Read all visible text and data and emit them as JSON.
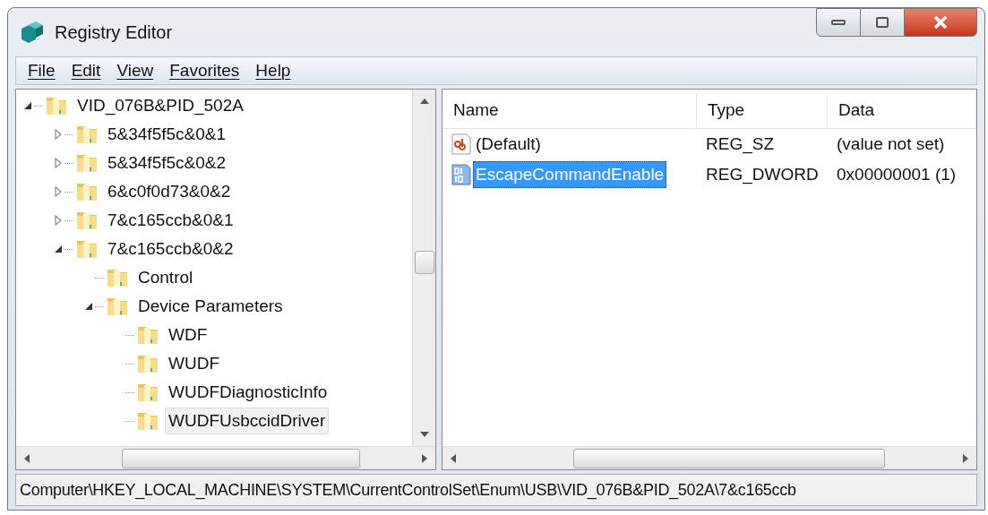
{
  "window": {
    "title": "Registry Editor"
  },
  "menu": [
    {
      "label": "File"
    },
    {
      "label": "Edit"
    },
    {
      "label": "View"
    },
    {
      "label": "Favorites"
    },
    {
      "label": "Help"
    }
  ],
  "tree": [
    {
      "label": "VID_076B&PID_502A",
      "kind": "branch",
      "expanded": true,
      "selected": false,
      "children": [
        {
          "label": "5&34f5f5c&0&1",
          "kind": "branch",
          "expanded": false,
          "selected": false
        },
        {
          "label": "5&34f5f5c&0&2",
          "kind": "branch",
          "expanded": false,
          "selected": false
        },
        {
          "label": "6&c0f0d73&0&2",
          "kind": "branch",
          "expanded": false,
          "selected": false
        },
        {
          "label": "7&c165ccb&0&1",
          "kind": "branch",
          "expanded": false,
          "selected": false
        },
        {
          "label": "7&c165ccb&0&2",
          "kind": "branch",
          "expanded": true,
          "selected": false,
          "children": [
            {
              "label": "Control",
              "kind": "leaf",
              "selected": false
            },
            {
              "label": "Device Parameters",
              "kind": "branch",
              "expanded": true,
              "selected": false,
              "children": [
                {
                  "label": "WDF",
                  "kind": "leaf",
                  "selected": false
                },
                {
                  "label": "WUDF",
                  "kind": "leaf",
                  "selected": false
                },
                {
                  "label": "WUDFDiagnosticInfo",
                  "kind": "leaf",
                  "selected": false
                },
                {
                  "label": "WUDFUsbccidDriver",
                  "kind": "leaf",
                  "selected": true
                }
              ]
            }
          ]
        }
      ]
    }
  ],
  "table": {
    "columns": [
      "Name",
      "Type",
      "Data"
    ],
    "rows": [
      {
        "kind": "string",
        "name": "(Default)",
        "type": "REG_SZ",
        "data": "(value not set)",
        "selected": false
      },
      {
        "kind": "binary",
        "name": "EscapeCommandEnable",
        "type": "REG_DWORD",
        "data": "0x00000001 (1)",
        "selected": true
      }
    ]
  },
  "status_bar": "Computer\\HKEY_LOCAL_MACHINE\\SYSTEM\\CurrentControlSet\\Enum\\USB\\VID_076B&PID_502A\\7&c165ccb"
}
